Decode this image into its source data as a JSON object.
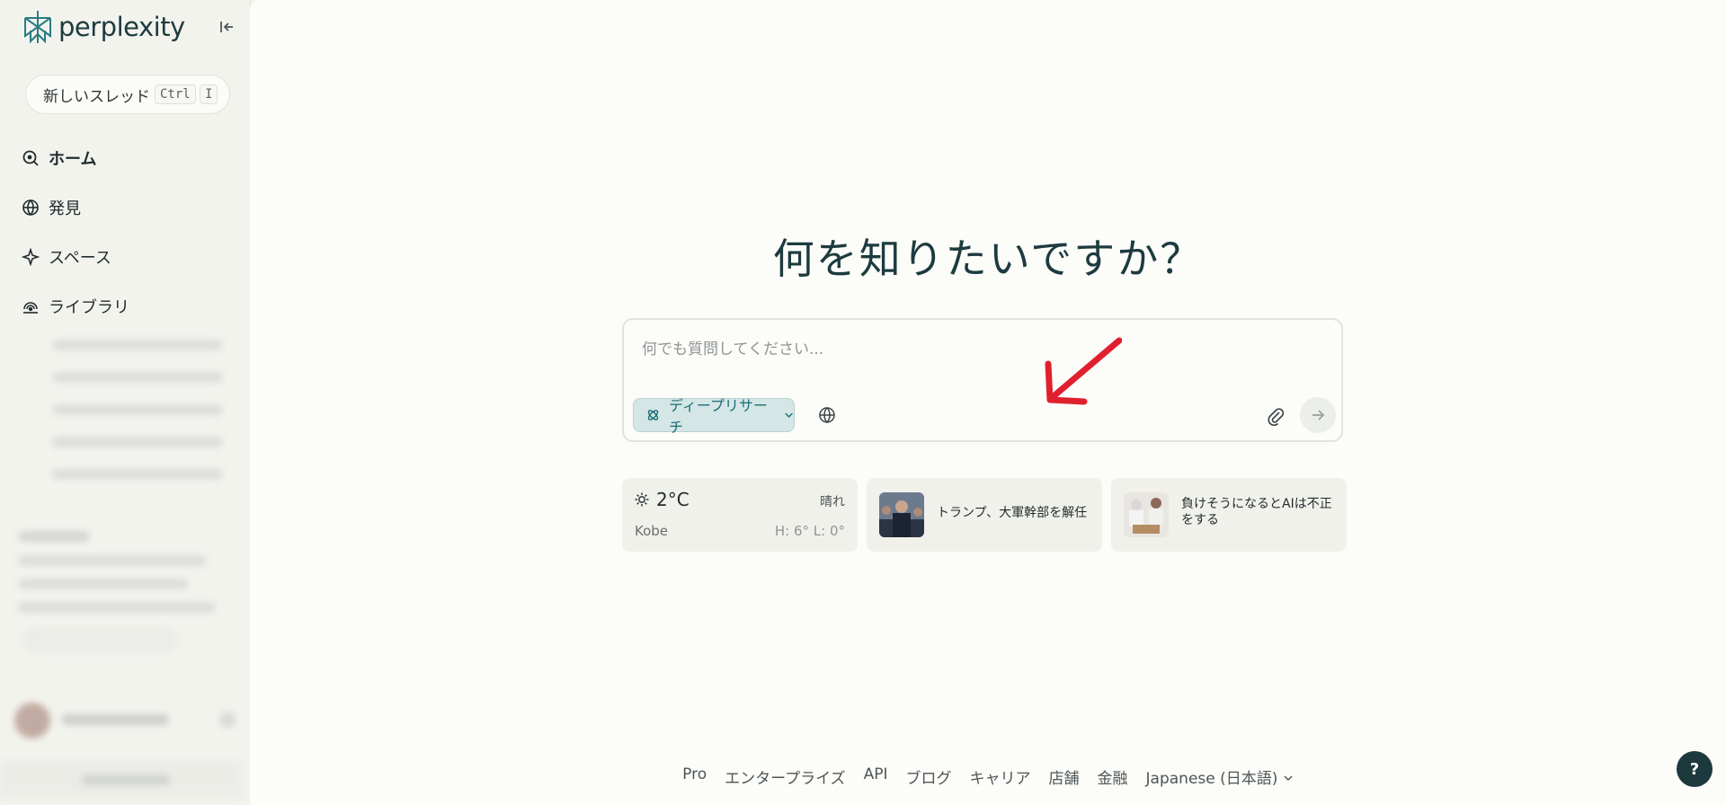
{
  "sidebar": {
    "logo_text": "perplexity",
    "new_thread": {
      "label": "新しいスレッド",
      "key1": "Ctrl",
      "key2": "I"
    },
    "nav": [
      {
        "label": "ホーム",
        "icon": "home-search-icon"
      },
      {
        "label": "発見",
        "icon": "globe-icon"
      },
      {
        "label": "スペース",
        "icon": "sparkle-icon"
      },
      {
        "label": "ライブラリ",
        "icon": "library-icon"
      }
    ]
  },
  "main": {
    "headline": "何を知りたいですか？",
    "search": {
      "placeholder": "何でも質問してください...",
      "mode_label": "ディープリサーチ"
    },
    "cards": {
      "weather": {
        "temp": "2°C",
        "condition": "晴れ",
        "city": "Kobe",
        "hilo": "H: 6° L: 0°"
      },
      "news1": {
        "text": "トランプ、大軍幹部を解任"
      },
      "news2": {
        "text": "負けそうになるとAIは不正をする"
      }
    },
    "footer": [
      "Pro",
      "エンタープライズ",
      "API",
      "ブログ",
      "キャリア",
      "店舗",
      "金融",
      "Japanese (日本語)"
    ],
    "help_label": "?"
  },
  "colors": {
    "accent": "#1b6f75",
    "brand": "#1d3b3f",
    "annotation_arrow": "#e0202e"
  }
}
